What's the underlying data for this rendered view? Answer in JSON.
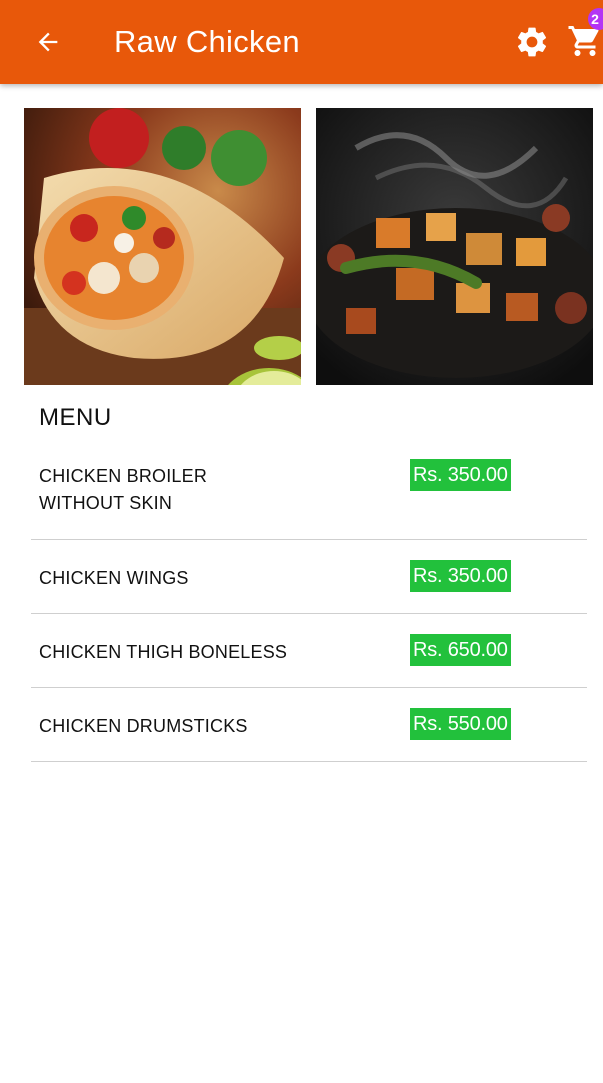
{
  "appbar": {
    "title": "Raw Chicken",
    "back_icon": "arrow-left-icon",
    "settings_icon": "gear-icon",
    "cart_icon": "shopping-cart-icon",
    "cart_count": "2",
    "background_color": "#e8580a",
    "badge_color": "#b434f5"
  },
  "gallery": [
    {
      "description": "chicken wrap with peppers and lime",
      "icon": "food-photo"
    },
    {
      "description": "stir-fried chicken with vegetables in pan",
      "icon": "food-photo"
    }
  ],
  "menu": {
    "heading": "MENU",
    "price_color": "#22c13c",
    "items": [
      {
        "name": "CHICKEN BROILER\nWITHOUT SKIN",
        "price": "Rs. 350.00"
      },
      {
        "name": "CHICKEN WINGS",
        "price": "Rs. 350.00"
      },
      {
        "name": "CHICKEN THIGH BONELESS",
        "price": "Rs. 650.00"
      },
      {
        "name": "CHICKEN DRUMSTICKS",
        "price": "Rs. 550.00"
      }
    ]
  }
}
